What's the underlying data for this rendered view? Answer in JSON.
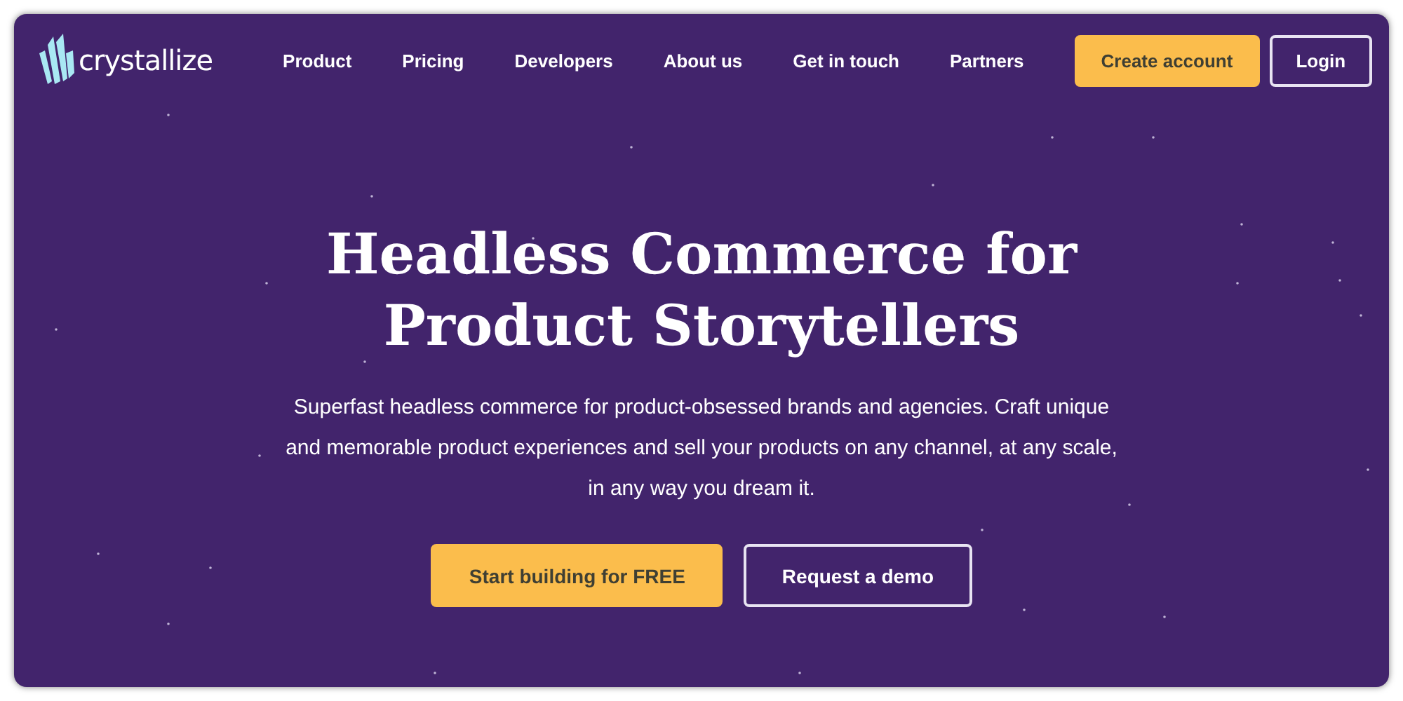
{
  "brand": {
    "name": "crystallize"
  },
  "nav": {
    "links": [
      "Product",
      "Pricing",
      "Developers",
      "About us",
      "Get in touch",
      "Partners"
    ],
    "actions": [
      {
        "label": "Create account",
        "kind": "primary"
      },
      {
        "label": "Login",
        "kind": "outline"
      }
    ]
  },
  "hero": {
    "title_lines": [
      "Headless Commerce for",
      "Product Storytellers"
    ],
    "description": "Superfast headless commerce for product-obsessed brands and agencies. Craft unique and memorable product experiences and sell your products on any channel, at any scale, in any way you dream it.",
    "actions": [
      {
        "label": "Start building for FREE",
        "kind": "primary"
      },
      {
        "label": "Request a demo",
        "kind": "outline"
      }
    ]
  }
}
